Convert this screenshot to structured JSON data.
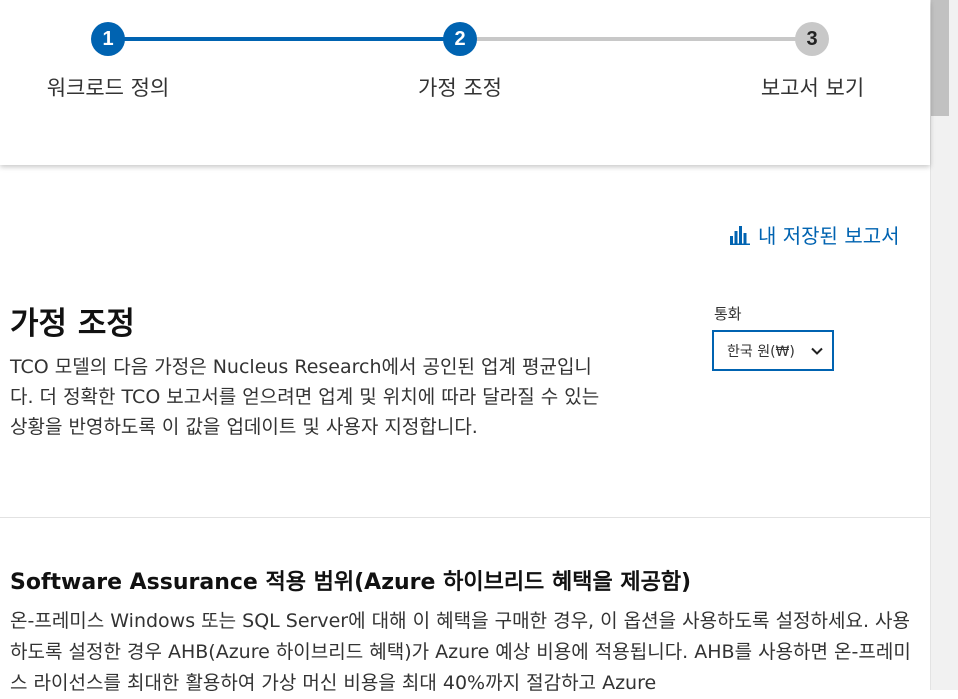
{
  "stepper": {
    "steps": [
      {
        "number": "1",
        "label": "워크로드 정의",
        "state": "done"
      },
      {
        "number": "2",
        "label": "가정 조정",
        "state": "active"
      },
      {
        "number": "3",
        "label": "보고서 보기",
        "state": "todo"
      }
    ]
  },
  "saved_reports_link": "내 저장된 보고서",
  "assumptions": {
    "title": "가정 조정",
    "description": "TCO 모델의 다음 가정은 Nucleus Research에서 공인된 업계 평균입니다. 더 정확한 TCO 보고서를 얻으려면 업계 및 위치에 따라 달라질 수 있는 상황을 반영하도록 이 값을 업데이트 및 사용자 지정합니다."
  },
  "currency": {
    "label": "통화",
    "selected": "한국 원(₩)"
  },
  "software_assurance": {
    "title": "Software Assurance 적용 범위(Azure 하이브리드 혜택을 제공함)",
    "description": "온-프레미스 Windows 또는 SQL Server에 대해 이 혜택을 구매한 경우, 이 옵션을 사용하도록 설정하세요. 사용하도록 설정한 경우 AHB(Azure 하이브리드 혜택)가 Azure 예상 비용에 적용됩니다. AHB를 사용하면 온-프레미스 라이선스를 최대한 활용하여 가상 머신 비용을 최대 40%까지 절감하고 Azure"
  },
  "colors": {
    "accent": "#0063b1",
    "inactive_step": "#c8c8c8"
  }
}
